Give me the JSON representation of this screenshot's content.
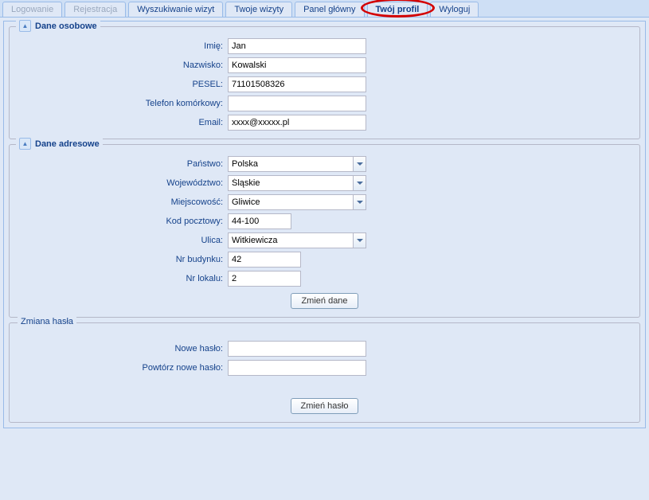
{
  "tabs": {
    "login": "Logowanie",
    "register": "Rejestracja",
    "search": "Wyszukiwanie wizyt",
    "your_visits": "Twoje wizyty",
    "dashboard": "Panel główny",
    "profile": "Twój profil",
    "logout": "Wyloguj"
  },
  "personal": {
    "legend": "Dane osobowe",
    "imie_label": "Imię:",
    "imie_value": "Jan",
    "nazwisko_label": "Nazwisko:",
    "nazwisko_value": "Kowalski",
    "pesel_label": "PESEL:",
    "pesel_value": "71101508326",
    "telefon_label": "Telefon komórkowy:",
    "telefon_value": "",
    "email_label": "Email:",
    "email_value": "xxxx@xxxxx.pl"
  },
  "address": {
    "legend": "Dane adresowe",
    "panstwo_label": "Państwo:",
    "panstwo_value": "Polska",
    "woj_label": "Województwo:",
    "woj_value": "Śląskie",
    "miejsc_label": "Miejscowość:",
    "miejsc_value": "Gliwice",
    "kod_label": "Kod pocztowy:",
    "kod_value": "44-100",
    "ulica_label": "Ulica:",
    "ulica_value": "Witkiewicza",
    "nrbud_label": "Nr budynku:",
    "nrbud_value": "42",
    "nrlok_label": "Nr lokalu:",
    "nrlok_value": "2"
  },
  "buttons": {
    "zmien_dane": "Zmień dane",
    "zmien_haslo": "Zmień hasło"
  },
  "password": {
    "legend": "Zmiana hasła",
    "nowe_label": "Nowe hasło:",
    "powtorz_label": "Powtórz nowe hasło:"
  }
}
